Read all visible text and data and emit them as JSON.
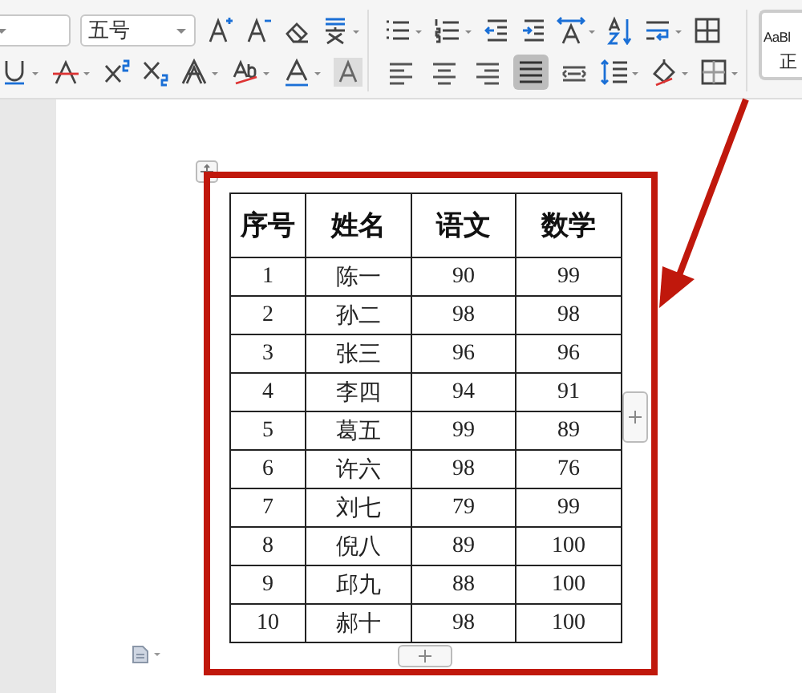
{
  "toolbar": {
    "font_size": "五号",
    "paragraph_alignment": [
      {
        "kind": "left",
        "selected": false
      },
      {
        "kind": "center",
        "selected": false
      },
      {
        "kind": "right",
        "selected": false
      },
      {
        "kind": "justify",
        "selected": true
      },
      {
        "kind": "distributed",
        "selected": false
      }
    ],
    "style_preview": {
      "sample": "AaBl",
      "name": "正"
    }
  },
  "table": {
    "columns": [
      "序号",
      "姓名",
      "语文",
      "数学"
    ],
    "rows": [
      [
        "1",
        "陈一",
        "90",
        "99"
      ],
      [
        "2",
        "孙二",
        "98",
        "98"
      ],
      [
        "3",
        "张三",
        "96",
        "96"
      ],
      [
        "4",
        "李四",
        "94",
        "91"
      ],
      [
        "5",
        "葛五",
        "99",
        "89"
      ],
      [
        "6",
        "许六",
        "98",
        "76"
      ],
      [
        "7",
        "刘七",
        "79",
        "99"
      ],
      [
        "8",
        "倪八",
        "89",
        "100"
      ],
      [
        "9",
        "邱九",
        "88",
        "100"
      ],
      [
        "10",
        "郝十",
        "98",
        "100"
      ]
    ]
  }
}
